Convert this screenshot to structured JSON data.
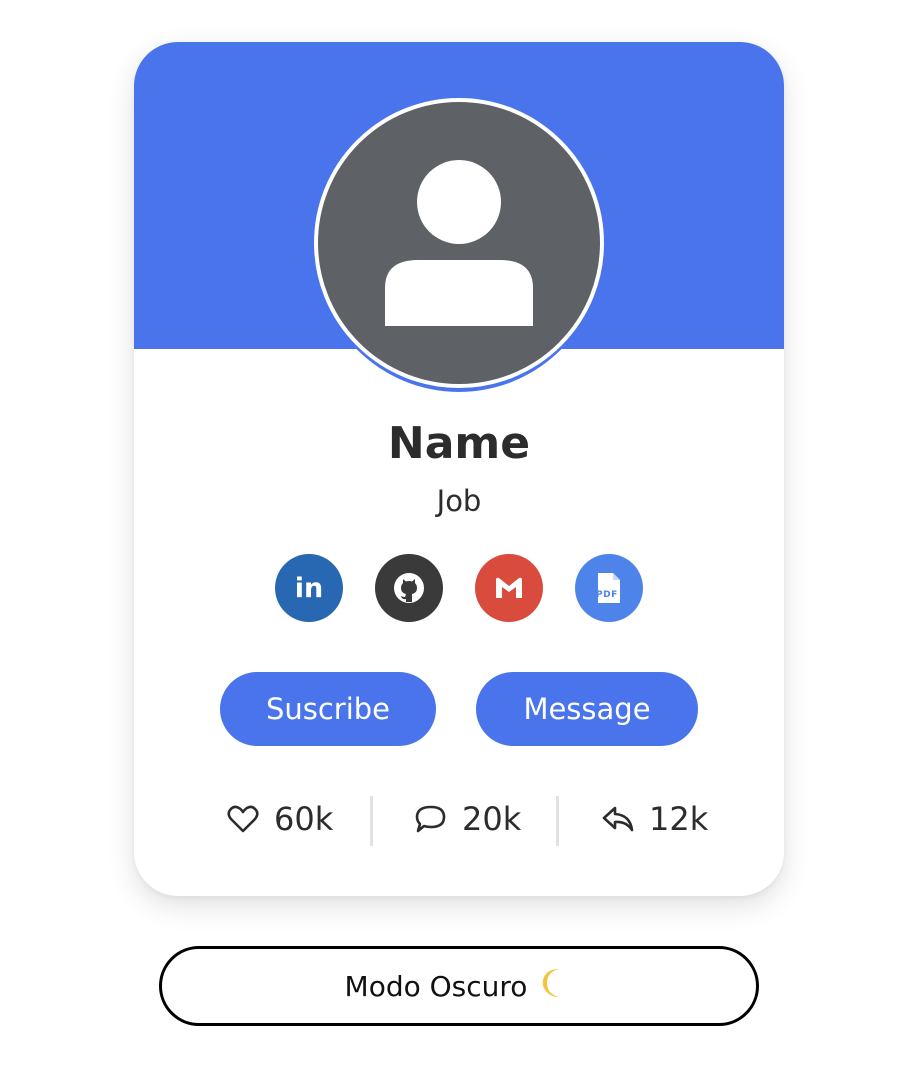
{
  "profile": {
    "name": "Name",
    "job": "Job"
  },
  "social_icons": [
    {
      "name": "linkedin-icon",
      "text": "in",
      "color": "#2867b2"
    },
    {
      "name": "github-icon",
      "color": "#3a3a3a"
    },
    {
      "name": "gmail-icon",
      "color": "#d94b3c"
    },
    {
      "name": "pdf-icon",
      "text": "PDF",
      "color": "#4e83ea"
    }
  ],
  "buttons": {
    "subscribe": "Suscribe",
    "message": "Message"
  },
  "stats": {
    "likes": "60k",
    "comments": "20k",
    "shares": "12k"
  },
  "toggle": {
    "label": "Modo Oscuro",
    "icon": "crescent-moon-icon"
  },
  "colors": {
    "accent": "#4a74eb",
    "avatar_bg": "#5e6266",
    "text": "#2c2c2c"
  }
}
